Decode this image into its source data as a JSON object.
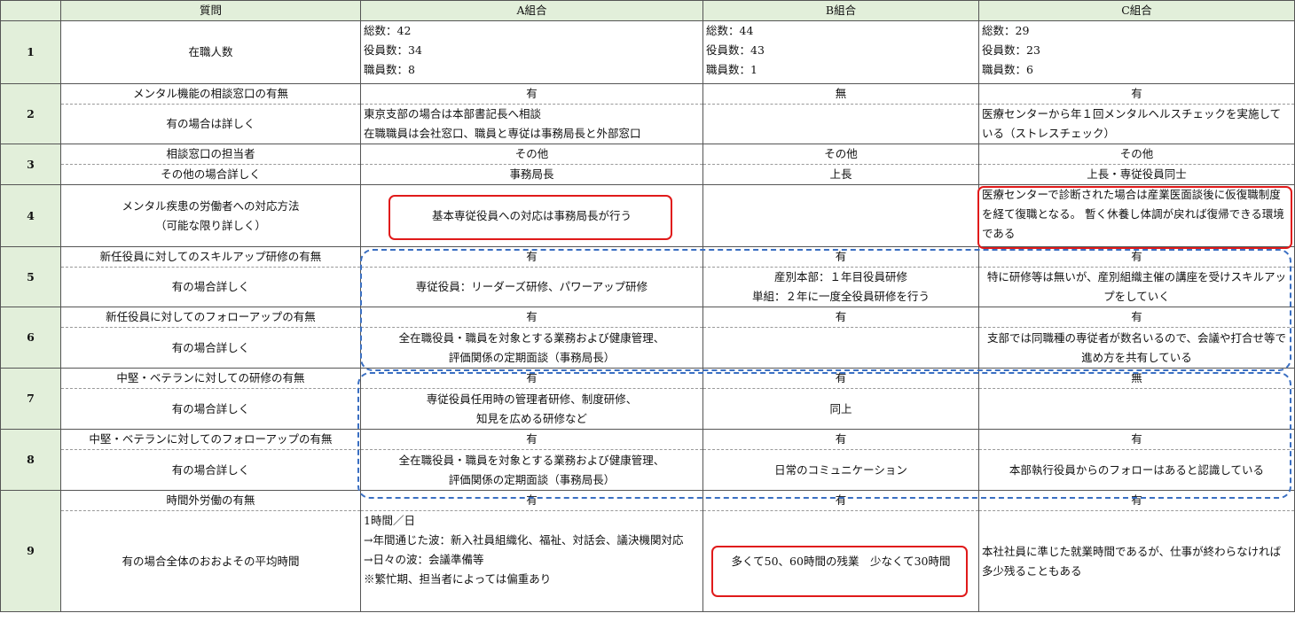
{
  "headers": [
    "",
    "質問",
    "A組合",
    "B組合",
    "C組合"
  ],
  "rows": [
    {
      "num": "1",
      "q": "在職人数",
      "a": "総数：42\n役員数：34\n職員数：8",
      "b": "総数：44\n役員数：43\n職員数：1",
      "c": "総数：29\n役員数：23\n職員数：6"
    },
    {
      "num": "2",
      "q1": "メンタル機能の相談窓口の有無",
      "a1": "有",
      "b1": "無",
      "c1": "有",
      "q2": "有の場合は詳しく",
      "a2": "東京支部の場合は本部書記長へ相談\n在職職員は会社窓口、職員と専従は事務局長と外部窓口",
      "b2": "",
      "c2": "医療センターから年１回メンタルヘルスチェックを実施している（ストレスチェック）"
    },
    {
      "num": "3",
      "q1": "相談窓口の担当者",
      "a1": "その他",
      "b1": "その他",
      "c1": "その他",
      "q2": "その他の場合詳しく",
      "a2": "事務局長",
      "b2": "上長",
      "c2": "上長・専従役員同士"
    },
    {
      "num": "4",
      "q": "メンタル疾患の労働者への対応方法\n（可能な限り詳しく）",
      "a": "基本専従役員への対応は事務局長が行う",
      "b": "",
      "c": "医療センターで診断された場合は産業医面談後に仮復職制度を経て復職となる。\n暫く休養し体調が戻れば復帰できる環境である"
    },
    {
      "num": "5",
      "q1": "新任役員に対してのスキルアップ研修の有無",
      "a1": "有",
      "b1": "有",
      "c1": "有",
      "q2": "有の場合詳しく",
      "a2": "専従役員：リーダーズ研修、パワーアップ研修",
      "b2": "産別本部：１年目役員研修\n単組：２年に一度全役員研修を行う",
      "c2": "特に研修等は無いが、産別組織主催の講座を受けスキルアップをしていく"
    },
    {
      "num": "6",
      "q1": "新任役員に対してのフォローアップの有無",
      "a1": "有",
      "b1": "有",
      "c1": "有",
      "q2": "有の場合詳しく",
      "a2": "全在職役員・職員を対象とする業務および健康管理、\n評価関係の定期面談（事務局長）",
      "b2": "",
      "c2": "支部では同職種の専従者が数名いるので、会議や打合せ等で進め方を共有している"
    },
    {
      "num": "7",
      "q1": "中堅・ベテランに対しての研修の有無",
      "a1": "有",
      "b1": "有",
      "c1": "無",
      "q2": "有の場合詳しく",
      "a2": "専従役員任用時の管理者研修、制度研修、\n知見を広める研修など",
      "b2": "同上",
      "c2": ""
    },
    {
      "num": "8",
      "q1": "中堅・ベテランに対してのフォローアップの有無",
      "a1": "有",
      "b1": "有",
      "c1": "有",
      "q2": "有の場合詳しく",
      "a2": "全在職役員・職員を対象とする業務および健康管理、\n評価関係の定期面談（事務局長）",
      "b2": "日常のコミュニケーション",
      "c2": "本部執行役員からのフォローはあると認識している"
    },
    {
      "num": "9",
      "q1": "時間外労働の有無",
      "a1": "有",
      "b1": "有",
      "c1": "有",
      "q2": "有の場合全体のおおよその平均時間",
      "a2": "1時間／日\n→年間通じた波：新入社員組織化、福祉、対話会、議決機関対応\n→日々の波：会議準備等\n※繁忙期、担当者によっては偏重あり",
      "b2": "多くて50、60時間の残業　少なくて30時間",
      "c2": "本社社員に準じた就業時間であるが、仕事が終わらなければ多少残ることもある"
    }
  ]
}
